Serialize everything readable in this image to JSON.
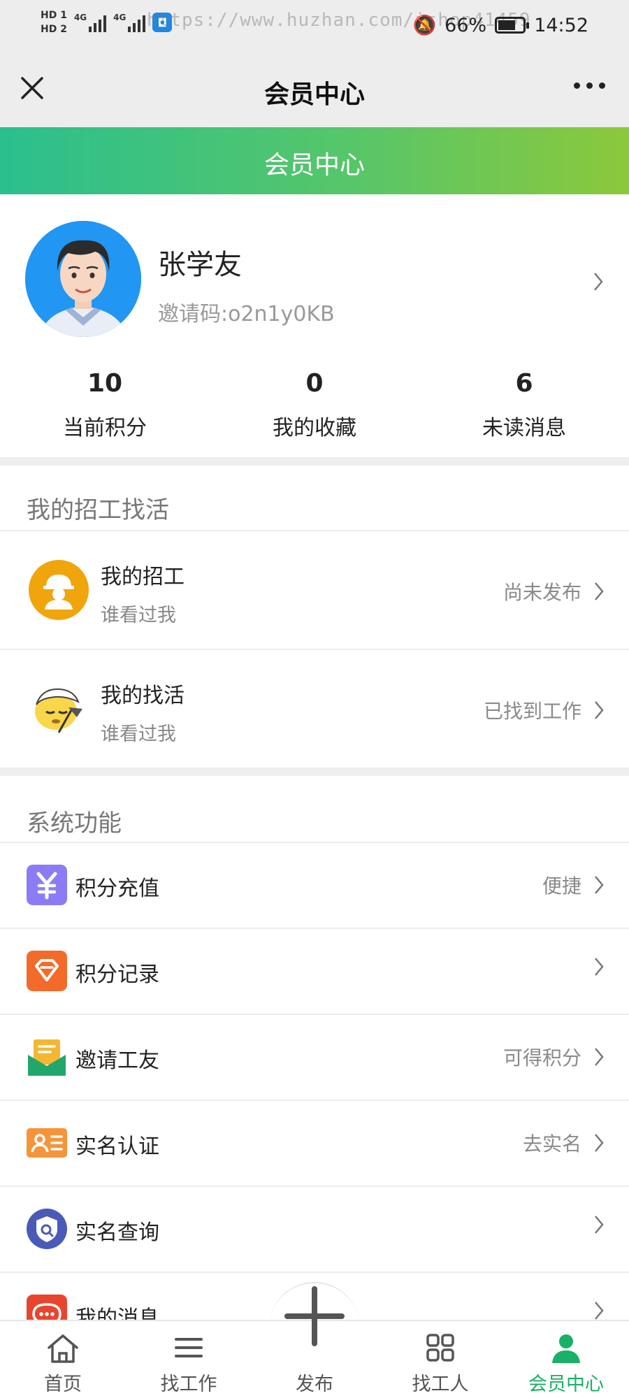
{
  "status_bar": {
    "hd1": "HD 1",
    "hd2": "HD 2",
    "net1": "4G",
    "net2": "4G",
    "watermark": "https://www.huzhan.com/ishop41459",
    "battery_percent": "66%",
    "battery_level": 0.66,
    "time": "14:52"
  },
  "nav": {
    "title": "会员中心"
  },
  "header": {
    "title": "会员中心"
  },
  "profile": {
    "name": "张学友",
    "invite_code": "邀请码:o2n1y0KB",
    "stats": [
      {
        "value": "10",
        "label": "当前积分"
      },
      {
        "value": "0",
        "label": "我的收藏"
      },
      {
        "value": "6",
        "label": "未读消息"
      }
    ]
  },
  "jobs_section": {
    "title": "我的招工找活",
    "items": [
      {
        "title": "我的招工",
        "subtitle": "谁看过我",
        "status": "尚未发布"
      },
      {
        "title": "我的找活",
        "subtitle": "谁看过我",
        "status": "已找到工作"
      }
    ]
  },
  "system_section": {
    "title": "系统功能",
    "items": [
      {
        "label": "积分充值",
        "hint": "便捷",
        "icon": "yuan-icon",
        "color": "#8b7cf6"
      },
      {
        "label": "积分记录",
        "hint": "",
        "icon": "diamond-icon",
        "color": "#f26b2a"
      },
      {
        "label": "邀请工友",
        "hint": "可得积分",
        "icon": "envelope-icon",
        "color": "#20a76b"
      },
      {
        "label": "实名认证",
        "hint": "去实名",
        "icon": "id-card-icon",
        "color": "#f7943a"
      },
      {
        "label": "实名查询",
        "hint": "",
        "icon": "shield-search-icon",
        "color": "#4a5ab8"
      },
      {
        "label": "我的消息",
        "hint": "",
        "icon": "chat-icon",
        "color": "#e8452c"
      }
    ]
  },
  "tabbar": {
    "active_color": "#19b067",
    "tabs": [
      {
        "label": "首页",
        "icon": "home-icon"
      },
      {
        "label": "找工作",
        "icon": "list-icon"
      },
      {
        "label": "发布",
        "icon": "plus-icon"
      },
      {
        "label": "找工人",
        "icon": "grid-icon"
      },
      {
        "label": "会员中心",
        "icon": "user-icon"
      }
    ]
  }
}
